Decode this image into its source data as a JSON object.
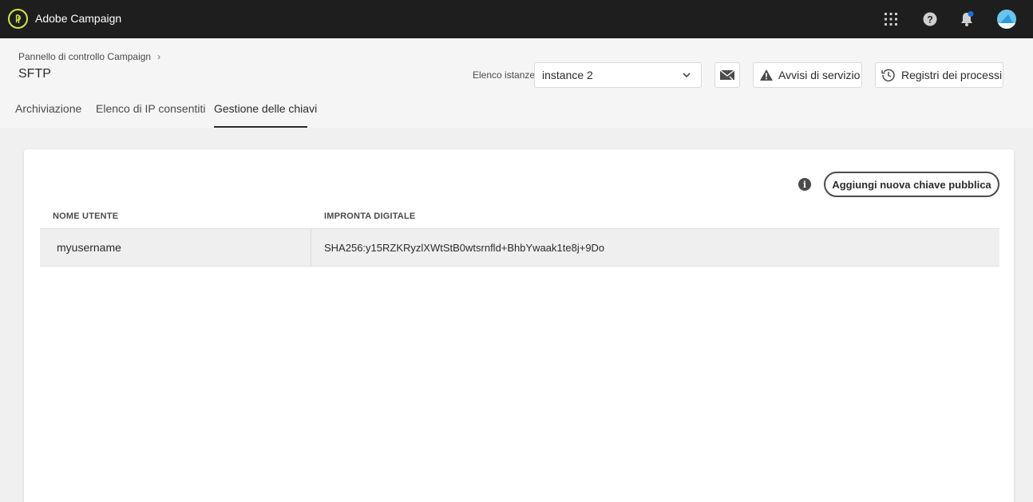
{
  "app": {
    "title": "Adobe Campaign"
  },
  "topbar": {
    "icons": [
      "logo-icon",
      "apps-grid-icon",
      "help-icon",
      "bell-icon",
      "avatar"
    ],
    "notification_color": "#1473e6",
    "avatar_color": "#6ac3ec"
  },
  "header": {
    "breadcrumb": "Pannello di controllo Campaign",
    "page_title": "SFTP",
    "instance_label": "Elenco istanze",
    "instance_value": "instance 2",
    "avvisi_label": "Avvisi di servizio",
    "registri_label": "Registri dei processi"
  },
  "tabs": [
    {
      "label": "Archiviazione",
      "active": false
    },
    {
      "label": "Elenco di IP consentiti",
      "active": false
    },
    {
      "label": "Gestione delle chiavi",
      "active": true
    }
  ],
  "card": {
    "add_button_label": "Aggiungi nuova chiave pubblica",
    "columns": [
      "NOME UTENTE",
      "IMPRONTA DIGITALE"
    ],
    "rows": [
      {
        "username": "myusername",
        "fingerprint": "SHA256:y15RZKRyzlXWtStB0wtsrnfld+BhbYwaak1te8j+9Do"
      }
    ]
  }
}
